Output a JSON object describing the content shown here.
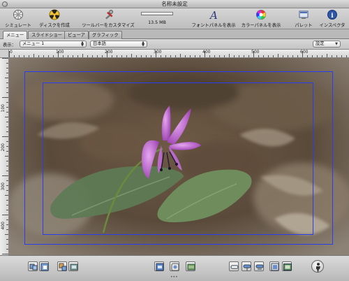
{
  "window": {
    "title": "名称未設定"
  },
  "toolbar": {
    "items": [
      {
        "label": "シミュレート",
        "icon": "simulate-icon"
      },
      {
        "label": "ディスクを作成",
        "icon": "burn-disc-icon"
      },
      {
        "label": "ツールバーをカスタマイズ",
        "icon": "customize-toolbar-icon"
      },
      {
        "label": "13.5 MB",
        "icon": "disc-capacity-meter"
      },
      {
        "label": "フォントパネルを表示",
        "icon": "font-panel-icon"
      },
      {
        "label": "カラーパネルを表示",
        "icon": "color-panel-icon"
      },
      {
        "label": "パレット",
        "icon": "palette-icon"
      },
      {
        "label": "インスペクタ",
        "icon": "inspector-icon"
      }
    ]
  },
  "tabs": [
    "メニュー",
    "スライドショー",
    "ビューア",
    "グラフィック"
  ],
  "options": {
    "display_label": "表示：",
    "menu_select": "メニュー 1",
    "language_select": "日本語",
    "settings_button": "設定"
  },
  "rulers": {
    "h_labels": [
      "0",
      "100",
      "200",
      "300",
      "400",
      "500",
      "600"
    ],
    "v_labels": [
      "100",
      "200",
      "300",
      "400"
    ]
  },
  "canvas": {
    "content": "menu-background-photo",
    "guide_color": "#2b3df0"
  },
  "bottom": {
    "more_indicator": "•••"
  }
}
